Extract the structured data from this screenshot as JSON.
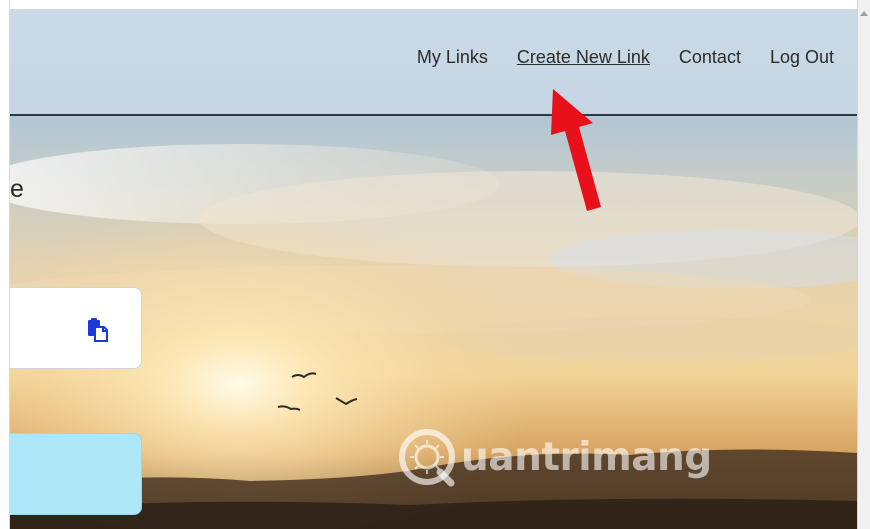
{
  "nav": {
    "items": [
      {
        "label": "My Links",
        "active": false
      },
      {
        "label": "Create New Link",
        "active": true
      },
      {
        "label": "Contact",
        "active": false
      },
      {
        "label": "Log Out",
        "active": false
      }
    ]
  },
  "main": {
    "heading_fragment": "e",
    "paste_icon": "paste-icon",
    "submit_button_label": ""
  },
  "annotation": {
    "arrow_color": "#e8101a"
  },
  "watermark": {
    "text": "uantrimang"
  },
  "colors": {
    "header_bg": "#cddbe7",
    "submit_bg": "#aee7f8",
    "nav_text": "#2b2b2b"
  }
}
